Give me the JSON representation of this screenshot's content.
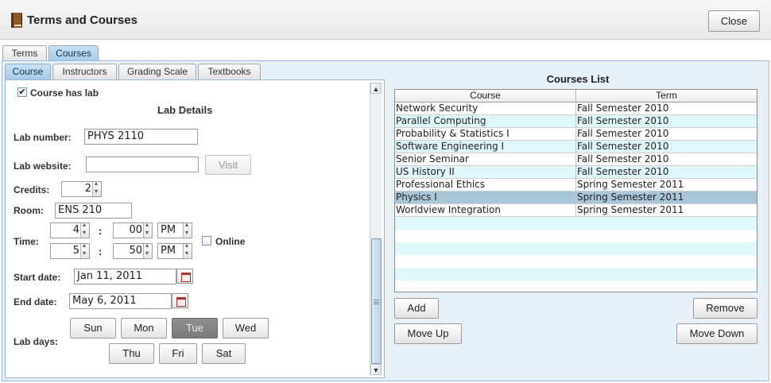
{
  "window": {
    "title": "Terms and Courses",
    "close_label": "Close"
  },
  "top_tabs": [
    {
      "label": "Terms"
    },
    {
      "label": "Courses"
    }
  ],
  "inner_tabs": [
    {
      "label": "Course"
    },
    {
      "label": "Instructors"
    },
    {
      "label": "Grading Scale"
    },
    {
      "label": "Textbooks"
    }
  ],
  "form": {
    "has_lab_label": "Course has lab",
    "has_lab_checked": "✔",
    "section_title": "Lab Details",
    "lab_number_label": "Lab number:",
    "lab_number_value": "PHYS 2110",
    "lab_website_label": "Lab website:",
    "lab_website_value": "",
    "visit_label": "Visit",
    "credits_label": "Credits:",
    "credits_value": "2",
    "room_label": "Room:",
    "room_value": "ENS 210",
    "time_label": "Time:",
    "start_hour": "4",
    "start_minute": "00",
    "start_ampm": "PM",
    "end_hour": "5",
    "end_minute": "50",
    "end_ampm": "PM",
    "colon": ":",
    "online_label": "Online",
    "start_date_label": "Start date:",
    "start_date_value": "Jan 11, 2011",
    "end_date_label": "End date:",
    "end_date_value": "May 6, 2011",
    "lab_days_label": "Lab days:",
    "days": [
      "Sun",
      "Mon",
      "Tue",
      "Wed",
      "Thu",
      "Fri",
      "Sat"
    ],
    "selected_day": "Tue"
  },
  "courses_list": {
    "title": "Courses List",
    "columns": [
      "Course",
      "Term"
    ],
    "rows": [
      {
        "course": "Network Security",
        "term": "Fall Semester 2010"
      },
      {
        "course": "Parallel Computing",
        "term": "Fall Semester 2010"
      },
      {
        "course": "Probability & Statistics I",
        "term": "Fall Semester 2010"
      },
      {
        "course": "Software Engineering I",
        "term": "Fall Semester 2010"
      },
      {
        "course": "Senior Seminar",
        "term": "Fall Semester 2010"
      },
      {
        "course": "US History II",
        "term": "Fall Semester 2010"
      },
      {
        "course": "Professional Ethics",
        "term": "Spring Semester 2011"
      },
      {
        "course": "Physics I",
        "term": "Spring Semester 2011"
      },
      {
        "course": "Worldview Integration",
        "term": "Spring Semester 2011"
      }
    ],
    "selected_course": "Physics I",
    "add_label": "Add",
    "remove_label": "Remove",
    "move_up_label": "Move Up",
    "move_down_label": "Move Down"
  },
  "colors": {
    "tab_active": "#a6cae8",
    "row_stripe": "#e0f8fb",
    "row_selected": "#a9c6d8",
    "panel_bg": "#e6f0f8"
  }
}
